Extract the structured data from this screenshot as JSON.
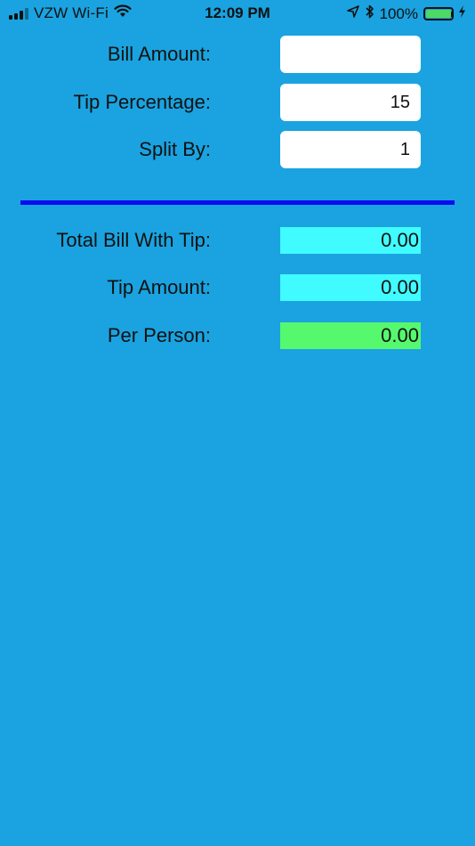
{
  "status_bar": {
    "carrier": "VZW Wi-Fi",
    "time": "12:09 PM",
    "battery_percent": "100%",
    "battery_color": "#4cd964",
    "icons": [
      "signal-icon",
      "wifi-icon",
      "location-arrow-icon",
      "bluetooth-icon",
      "battery-icon",
      "charging-bolt-icon"
    ]
  },
  "form": {
    "bill_amount": {
      "label": "Bill Amount:",
      "value": ""
    },
    "tip_percentage": {
      "label": "Tip Percentage:",
      "value": "15"
    },
    "split_by": {
      "label": "Split By:",
      "value": "1"
    }
  },
  "results": {
    "total_bill_with_tip": {
      "label": "Total Bill With Tip:",
      "value": "0.00",
      "color": "#40fbff"
    },
    "tip_amount": {
      "label": "Tip Amount:",
      "value": "0.00",
      "color": "#40fbff"
    },
    "per_person": {
      "label": "Per Person:",
      "value": "0.00",
      "color": "#56f96e"
    }
  },
  "colors": {
    "background": "#1aa3e0",
    "divider": "#0b0bf0"
  }
}
